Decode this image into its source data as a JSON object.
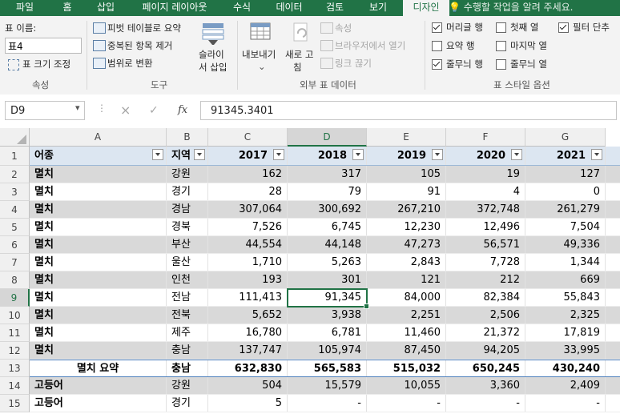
{
  "ribbon": {
    "tabs": [
      "파일",
      "홈",
      "삽입",
      "페이지 레이아웃",
      "수식",
      "데이터",
      "검토",
      "보기",
      "디자인"
    ],
    "active_tab": "디자인",
    "tell_me": "수행할 작업을 알려 주세요.",
    "properties": {
      "table_name_label": "표 이름:",
      "table_name_value": "표4",
      "resize_label": "표 크기 조정",
      "group_label": "속성"
    },
    "tools": {
      "pivot_label": "피벗 테이블로 요약",
      "remove_dup_label": "중복된 항목 제거",
      "convert_label": "범위로 변환",
      "slicer_line1": "슬라이",
      "slicer_line2": "서 삽입",
      "group_label": "도구"
    },
    "external": {
      "export_label": "내보내기",
      "refresh_line1": "새로 고",
      "refresh_line2": "침",
      "properties_label": "속성",
      "open_browser_label": "브라우저에서 열기",
      "unlink_label": "링크 끊기",
      "group_label": "외부 표 데이터"
    },
    "style_options": {
      "header_row": "머리글 행",
      "total_row": "요약 행",
      "banded_rows": "줄무늬 행",
      "first_column": "첫째 열",
      "last_column": "마지막 열",
      "banded_columns": "줄무늬 열",
      "filter_button": "필터 단추",
      "group_label": "표 스타일 옵션"
    }
  },
  "formula_bar": {
    "name_box": "D9",
    "cancel_icon": "×",
    "enter_icon": "✓",
    "fx_label": "fx",
    "formula": "91345.3401"
  },
  "sheet": {
    "columns": [
      "A",
      "B",
      "C",
      "D",
      "E",
      "F",
      "G"
    ],
    "row_numbers": [
      "1",
      "2",
      "3",
      "4",
      "5",
      "6",
      "7",
      "8",
      "9",
      "10",
      "11",
      "12",
      "13",
      "14",
      "15"
    ],
    "headers": [
      "어종",
      "지역",
      "2017",
      "2018",
      "2019",
      "2020",
      "2021"
    ],
    "rows": [
      [
        "멸치",
        "강원",
        "162",
        "317",
        "105",
        "19",
        "127"
      ],
      [
        "멸치",
        "경기",
        "28",
        "79",
        "91",
        "4",
        "0"
      ],
      [
        "멸치",
        "경남",
        "307,064",
        "300,692",
        "267,210",
        "372,748",
        "261,279"
      ],
      [
        "멸치",
        "경북",
        "7,526",
        "6,745",
        "12,230",
        "12,496",
        "7,504"
      ],
      [
        "멸치",
        "부산",
        "44,554",
        "44,148",
        "47,273",
        "56,571",
        "49,336"
      ],
      [
        "멸치",
        "울산",
        "1,710",
        "5,263",
        "2,843",
        "7,728",
        "1,344"
      ],
      [
        "멸치",
        "인천",
        "193",
        "301",
        "121",
        "212",
        "669"
      ],
      [
        "멸치",
        "전남",
        "111,413",
        "91,345",
        "84,000",
        "82,384",
        "55,843"
      ],
      [
        "멸치",
        "전북",
        "5,652",
        "3,938",
        "2,251",
        "2,506",
        "2,325"
      ],
      [
        "멸치",
        "제주",
        "16,780",
        "6,781",
        "11,460",
        "21,372",
        "17,819"
      ],
      [
        "멸치",
        "충남",
        "137,747",
        "105,974",
        "87,450",
        "94,205",
        "33,995"
      ],
      [
        "멸치 요약",
        "충남",
        "632,830",
        "565,583",
        "515,032",
        "650,245",
        "430,240"
      ],
      [
        "고등어",
        "강원",
        "504",
        "15,579",
        "10,055",
        "3,360",
        "2,409"
      ],
      [
        "고등어",
        "경기",
        "5",
        "-",
        "-",
        "-",
        "-"
      ]
    ],
    "colors": {
      "header_fill": "#dce6f1",
      "band_fill": "#d9d9d9",
      "accent": "#217346"
    }
  }
}
